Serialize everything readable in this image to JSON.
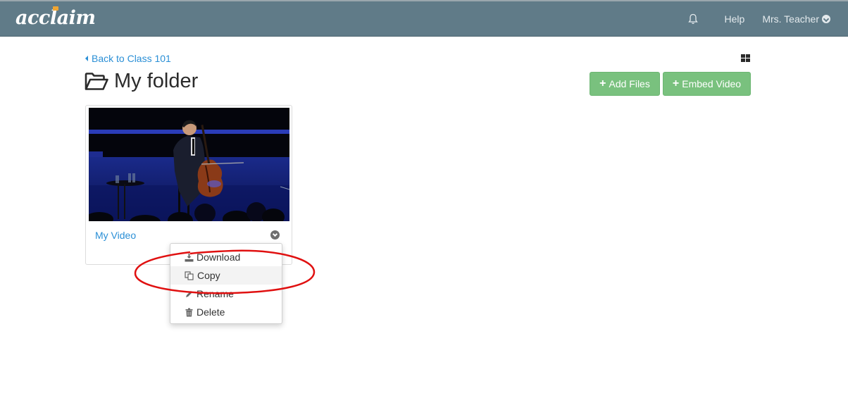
{
  "header": {
    "logo": "acclaim",
    "nav": {
      "notifications_icon": "bell-icon",
      "help": "Help",
      "user": "Mrs. Teacher",
      "user_menu_icon": "chevron-circle-down-icon"
    }
  },
  "breadcrumb": {
    "back_label": "Back to Class 101",
    "back_icon": "caret-left-icon"
  },
  "view_toggle_icon": "grid-icon",
  "page": {
    "title": "My folder",
    "title_icon": "folder-open-icon"
  },
  "actions": {
    "add_files": "Add Files",
    "embed_video": "Embed Video",
    "accent_color": "#79c17e"
  },
  "files": [
    {
      "title": "My Video",
      "thumbnail": "cellist performing on stage",
      "menu_icon": "chevron-circle-down-icon"
    }
  ],
  "context_menu": {
    "items": [
      {
        "label": "Download",
        "icon": "download-icon"
      },
      {
        "label": "Copy",
        "icon": "copy-icon",
        "highlighted": true
      },
      {
        "label": "Rename",
        "icon": "pencil-icon"
      },
      {
        "label": "Delete",
        "icon": "trash-icon"
      }
    ]
  },
  "annotation": {
    "shape": "ellipse",
    "color": "#e01010",
    "target": "Copy"
  }
}
